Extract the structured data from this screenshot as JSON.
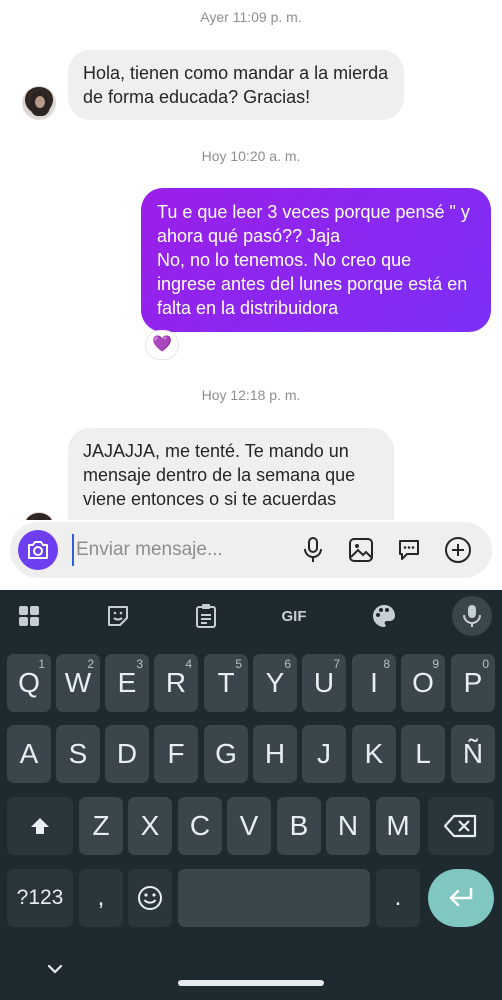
{
  "chat": {
    "timestamps": [
      "Ayer 11:09 p. m.",
      "Hoy 10:20 a. m.",
      "Hoy 12:18 p. m."
    ],
    "messages": [
      {
        "text": "Hola, tienen como mandar a la mierda de forma educada? Gracias!"
      },
      {
        "text": "Tu e que leer 3 veces porque pensé \" y ahora qué pasó?? Jaja\nNo, no lo tenemos. No creo que ingrese antes del lunes porque está en falta en la distribuidora",
        "reaction": "💜"
      },
      {
        "text": "JAJAJJA, me tenté. Te mando un mensaje dentro de la semana que viene entonces o si te acuerdas"
      }
    ]
  },
  "composer": {
    "placeholder": "Enviar mensaje...",
    "icons": [
      "camera-icon",
      "microphone-icon",
      "gallery-icon",
      "sticker-chat-icon",
      "add-icon"
    ],
    "accent": "#6e3ff0"
  },
  "keyboard": {
    "toolbar": [
      "apps-icon",
      "sticker-icon",
      "clipboard-icon",
      "GIF",
      "palette-icon",
      "mic-icon"
    ],
    "row1": [
      [
        "Q",
        "1"
      ],
      [
        "W",
        "2"
      ],
      [
        "E",
        "3"
      ],
      [
        "R",
        "4"
      ],
      [
        "T",
        "5"
      ],
      [
        "Y",
        "6"
      ],
      [
        "U",
        "7"
      ],
      [
        "I",
        "8"
      ],
      [
        "O",
        "9"
      ],
      [
        "P",
        "0"
      ]
    ],
    "row2": [
      "A",
      "S",
      "D",
      "F",
      "G",
      "H",
      "J",
      "K",
      "L",
      "Ñ"
    ],
    "row3": [
      "Z",
      "X",
      "C",
      "V",
      "B",
      "N",
      "M"
    ],
    "row4": {
      "symbols": "?123",
      "comma": ",",
      "period": "."
    },
    "colors": {
      "background": "#1f2a30",
      "key": "#3b464c",
      "enter": "#7fc7c0"
    }
  }
}
